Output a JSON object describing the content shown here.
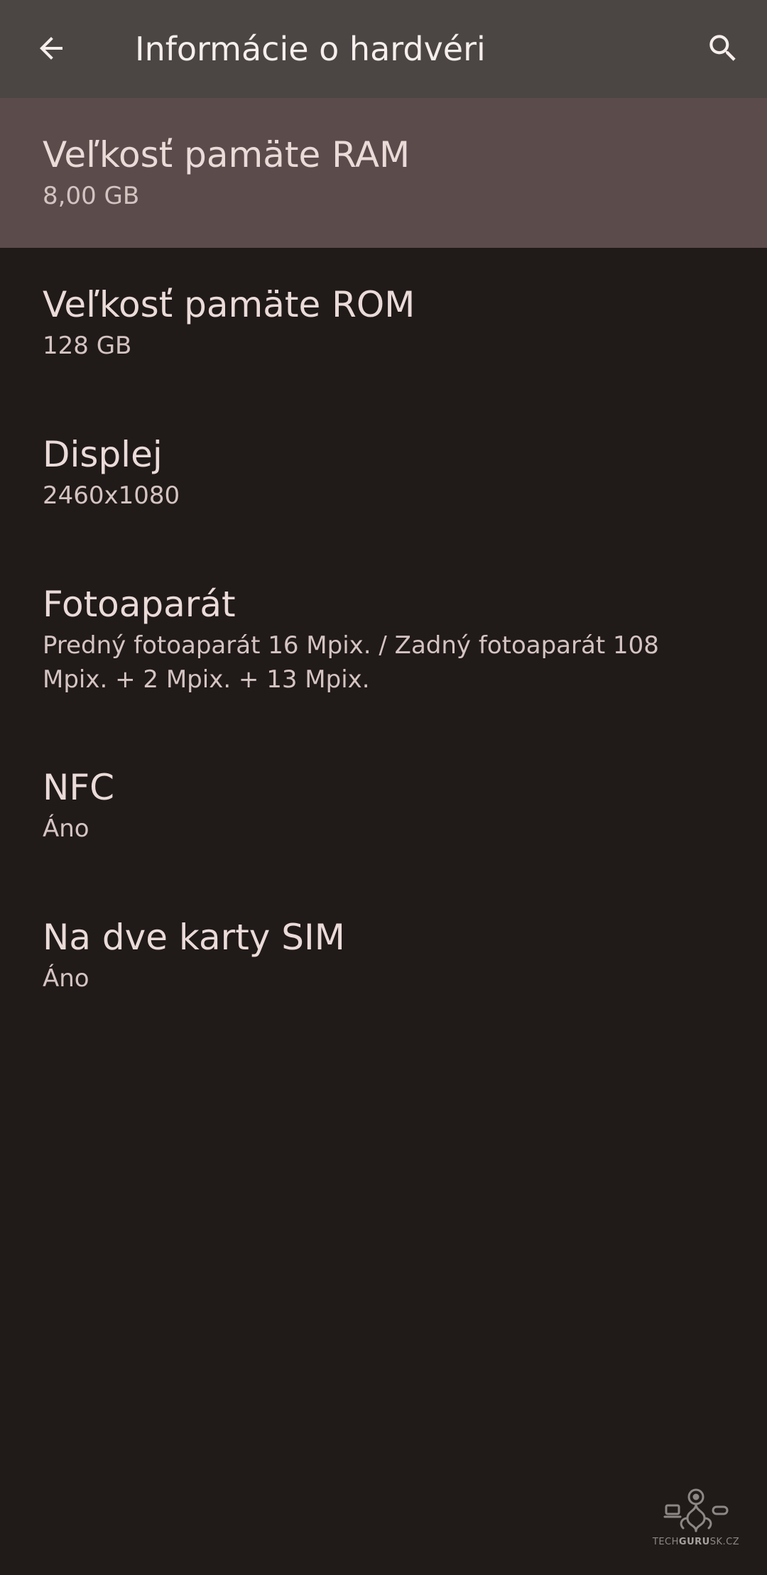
{
  "app_bar": {
    "title": "Informácie o hardvéri",
    "back_icon": "arrow-back-icon",
    "search_icon": "search-icon"
  },
  "colors": {
    "background": "#201a19",
    "app_bar": "#4b4544",
    "selected_row": "#5c4b4b",
    "title_text": "#eadbd8",
    "value_text": "#d4c4c1"
  },
  "items": [
    {
      "title": "Veľkosť pamäte RAM",
      "value": "8,00 GB"
    },
    {
      "title": "Veľkosť pamäte ROM",
      "value": "128 GB"
    },
    {
      "title": "Displej",
      "value": "2460x1080"
    },
    {
      "title": "Fotoaparát",
      "value": "Predný fotoaparát 16 Mpix. / Zadný fotoaparát 108 Mpix. + 2 Mpix. + 13 Mpix."
    },
    {
      "title": "NFC",
      "value": "Áno"
    },
    {
      "title": "Na dve karty SIM",
      "value": "Áno"
    }
  ],
  "watermark": {
    "prefix": "TECH",
    "bold": "GURU",
    "suffix": "SK.CZ"
  }
}
